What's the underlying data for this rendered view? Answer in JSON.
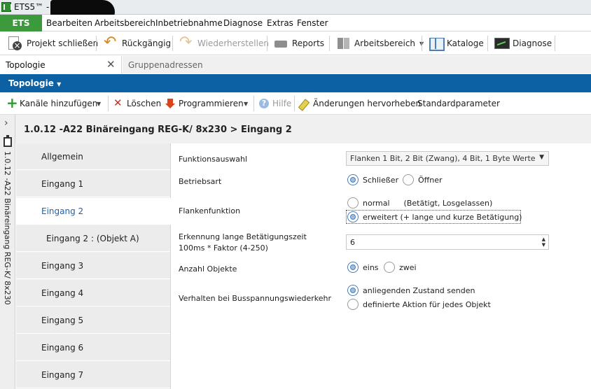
{
  "window": {
    "title": "ETS5™ -"
  },
  "menubar": {
    "app_button": "ETS",
    "items": [
      "Bearbeiten",
      "Arbeitsbereich",
      "Inbetriebnahme",
      "Diagnose",
      "Extras",
      "Fenster"
    ]
  },
  "toolbar": {
    "close_project": "Projekt schließen",
    "undo": "Rückgängig",
    "redo": "Wiederherstellen",
    "reports": "Reports",
    "workspace": "Arbeitsbereich",
    "catalogs": "Kataloge",
    "diagnose": "Diagnose"
  },
  "tabs": {
    "active": "Topologie",
    "inactive": "Gruppenadressen"
  },
  "panel": {
    "title": "Topologie"
  },
  "toolbar2": {
    "add_channels": "Kanäle hinzufügen",
    "delete": "Löschen",
    "program": "Programmieren",
    "help": "Hilfe",
    "highlight_changes": "Änderungen hervorheben",
    "default_params": "Standardparameter"
  },
  "side": {
    "device": "1.0.12 -A22 Binäreingang REG-K/ 8x230"
  },
  "breadcrumb": "1.0.12 -A22 Binäreingang REG-K/ 8x230 > Eingang 2",
  "nav": {
    "items": [
      {
        "label": "Allgemein"
      },
      {
        "label": "Eingang 1"
      },
      {
        "label": "Eingang 2"
      },
      {
        "label": "Eingang 2 : (Objekt A)"
      },
      {
        "label": "Eingang 3"
      },
      {
        "label": "Eingang 4"
      },
      {
        "label": "Eingang 5"
      },
      {
        "label": "Eingang 6"
      },
      {
        "label": "Eingang 7"
      }
    ],
    "active_index": 2
  },
  "params": {
    "funktionsauswahl": {
      "label": "Funktionsauswahl",
      "value": "Flanken 1 Bit, 2 Bit (Zwang), 4 Bit, 1 Byte Werte"
    },
    "betriebsart": {
      "label": "Betriebsart",
      "options": [
        "Schließer",
        "Öffner"
      ],
      "selected": 0
    },
    "flankenfunktion": {
      "label": "Flankenfunktion",
      "options": [
        {
          "text": "normal",
          "hint": "(Betätigt, Losgelassen)"
        },
        {
          "text": "erweitert  (+ lange und kurze Betätigung)"
        }
      ],
      "selected": 1
    },
    "erkennung": {
      "label_line1": "Erkennung lange Betätigungszeit",
      "label_line2": "100ms * Faktor (4-250)",
      "value": "6"
    },
    "anzahl_objekte": {
      "label": "Anzahl Objekte",
      "options": [
        "eins",
        "zwei"
      ],
      "selected": 0
    },
    "verhalten": {
      "label": "Verhalten bei Busspannungswiederkehr",
      "options": [
        "anliegenden Zustand senden",
        "definierte Aktion für jedes Objekt"
      ],
      "selected": 0
    }
  }
}
